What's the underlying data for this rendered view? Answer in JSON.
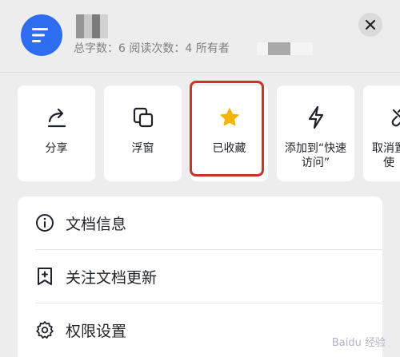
{
  "header": {
    "meta_text": "总字数：6  阅读次数：4  所有者",
    "icons": {
      "avatar": "doc-lines-icon",
      "close": "close-icon"
    }
  },
  "actions": [
    {
      "label": "分享",
      "icon": "share-arrow-icon"
    },
    {
      "label": "浮窗",
      "icon": "floating-window-icon"
    },
    {
      "label": "已收藏",
      "icon": "star-icon",
      "selected": true
    },
    {
      "label": "添加到“快速访问”",
      "icon": "lightning-icon"
    },
    {
      "label": "取消置使",
      "icon": "unlink-icon"
    }
  ],
  "menu": [
    {
      "label": "文档信息",
      "icon": "info-icon"
    },
    {
      "label": "关注文档更新",
      "icon": "bookmark-plus-icon"
    },
    {
      "label": "权限设置",
      "icon": "gear-icon"
    }
  ],
  "watermark": "Baidu 经验",
  "colors": {
    "accent_blue": "#2f6df0",
    "star_yellow": "#f5b400",
    "highlight_red": "#c9332c"
  }
}
